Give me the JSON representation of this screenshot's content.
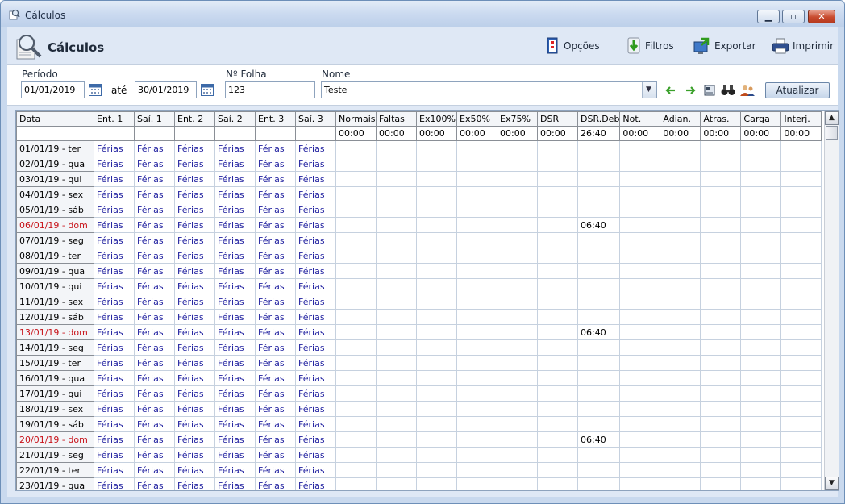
{
  "window": {
    "title": "Cálculos"
  },
  "header": {
    "title": "Cálculos"
  },
  "toolbar": {
    "options": "Opções",
    "filters": "Filtros",
    "export": "Exportar",
    "print": "Imprimir"
  },
  "filters": {
    "period_label": "Período",
    "date_from": "01/01/2019",
    "ate_label": "até",
    "date_to": "30/01/2019",
    "sheet_label": "Nº Folha",
    "sheet": "123",
    "name_label": "Nome",
    "name": "Teste",
    "refresh": "Atualizar"
  },
  "grid": {
    "columns": [
      "Data",
      "Ent. 1",
      "Saí. 1",
      "Ent. 2",
      "Saí. 2",
      "Ent. 3",
      "Saí. 3",
      "Normais",
      "Faltas",
      "Ex100%",
      "Ex50%",
      "Ex75%",
      "DSR",
      "DSR.Deb",
      "Not.",
      "Adian.",
      "Atras.",
      "Carga",
      "Interj."
    ],
    "totals": [
      "",
      "",
      "",
      "",
      "",
      "",
      "",
      "00:00",
      "00:00",
      "00:00",
      "00:00",
      "00:00",
      "00:00",
      "26:40",
      "00:00",
      "00:00",
      "00:00",
      "00:00",
      "00:00"
    ],
    "rows": [
      {
        "date": "01/01/19 - ter",
        "sunday": false,
        "marks": [
          "Férias",
          "Férias",
          "Férias",
          "Férias",
          "Férias",
          "Férias"
        ],
        "dsr_deb": ""
      },
      {
        "date": "02/01/19 - qua",
        "sunday": false,
        "marks": [
          "Férias",
          "Férias",
          "Férias",
          "Férias",
          "Férias",
          "Férias"
        ],
        "dsr_deb": ""
      },
      {
        "date": "03/01/19 - qui",
        "sunday": false,
        "marks": [
          "Férias",
          "Férias",
          "Férias",
          "Férias",
          "Férias",
          "Férias"
        ],
        "dsr_deb": ""
      },
      {
        "date": "04/01/19 - sex",
        "sunday": false,
        "marks": [
          "Férias",
          "Férias",
          "Férias",
          "Férias",
          "Férias",
          "Férias"
        ],
        "dsr_deb": ""
      },
      {
        "date": "05/01/19 - sáb",
        "sunday": false,
        "marks": [
          "Férias",
          "Férias",
          "Férias",
          "Férias",
          "Férias",
          "Férias"
        ],
        "dsr_deb": ""
      },
      {
        "date": "06/01/19 - dom",
        "sunday": true,
        "marks": [
          "Férias",
          "Férias",
          "Férias",
          "Férias",
          "Férias",
          "Férias"
        ],
        "dsr_deb": "06:40"
      },
      {
        "date": "07/01/19 - seg",
        "sunday": false,
        "marks": [
          "Férias",
          "Férias",
          "Férias",
          "Férias",
          "Férias",
          "Férias"
        ],
        "dsr_deb": ""
      },
      {
        "date": "08/01/19 - ter",
        "sunday": false,
        "marks": [
          "Férias",
          "Férias",
          "Férias",
          "Férias",
          "Férias",
          "Férias"
        ],
        "dsr_deb": ""
      },
      {
        "date": "09/01/19 - qua",
        "sunday": false,
        "marks": [
          "Férias",
          "Férias",
          "Férias",
          "Férias",
          "Férias",
          "Férias"
        ],
        "dsr_deb": ""
      },
      {
        "date": "10/01/19 - qui",
        "sunday": false,
        "marks": [
          "Férias",
          "Férias",
          "Férias",
          "Férias",
          "Férias",
          "Férias"
        ],
        "dsr_deb": ""
      },
      {
        "date": "11/01/19 - sex",
        "sunday": false,
        "marks": [
          "Férias",
          "Férias",
          "Férias",
          "Férias",
          "Férias",
          "Férias"
        ],
        "dsr_deb": ""
      },
      {
        "date": "12/01/19 - sáb",
        "sunday": false,
        "marks": [
          "Férias",
          "Férias",
          "Férias",
          "Férias",
          "Férias",
          "Férias"
        ],
        "dsr_deb": ""
      },
      {
        "date": "13/01/19 - dom",
        "sunday": true,
        "marks": [
          "Férias",
          "Férias",
          "Férias",
          "Férias",
          "Férias",
          "Férias"
        ],
        "dsr_deb": "06:40"
      },
      {
        "date": "14/01/19 - seg",
        "sunday": false,
        "marks": [
          "Férias",
          "Férias",
          "Férias",
          "Férias",
          "Férias",
          "Férias"
        ],
        "dsr_deb": ""
      },
      {
        "date": "15/01/19 - ter",
        "sunday": false,
        "marks": [
          "Férias",
          "Férias",
          "Férias",
          "Férias",
          "Férias",
          "Férias"
        ],
        "dsr_deb": ""
      },
      {
        "date": "16/01/19 - qua",
        "sunday": false,
        "marks": [
          "Férias",
          "Férias",
          "Férias",
          "Férias",
          "Férias",
          "Férias"
        ],
        "dsr_deb": ""
      },
      {
        "date": "17/01/19 - qui",
        "sunday": false,
        "marks": [
          "Férias",
          "Férias",
          "Férias",
          "Férias",
          "Férias",
          "Férias"
        ],
        "dsr_deb": ""
      },
      {
        "date": "18/01/19 - sex",
        "sunday": false,
        "marks": [
          "Férias",
          "Férias",
          "Férias",
          "Férias",
          "Férias",
          "Férias"
        ],
        "dsr_deb": ""
      },
      {
        "date": "19/01/19 - sáb",
        "sunday": false,
        "marks": [
          "Férias",
          "Férias",
          "Férias",
          "Férias",
          "Férias",
          "Férias"
        ],
        "dsr_deb": ""
      },
      {
        "date": "20/01/19 - dom",
        "sunday": true,
        "marks": [
          "Férias",
          "Férias",
          "Férias",
          "Férias",
          "Férias",
          "Férias"
        ],
        "dsr_deb": "06:40"
      },
      {
        "date": "21/01/19 - seg",
        "sunday": false,
        "marks": [
          "Férias",
          "Férias",
          "Férias",
          "Férias",
          "Férias",
          "Férias"
        ],
        "dsr_deb": ""
      },
      {
        "date": "22/01/19 - ter",
        "sunday": false,
        "marks": [
          "Férias",
          "Férias",
          "Férias",
          "Férias",
          "Férias",
          "Férias"
        ],
        "dsr_deb": ""
      },
      {
        "date": "23/01/19 - qua",
        "sunday": false,
        "marks": [
          "Férias",
          "Férias",
          "Férias",
          "Férias",
          "Férias",
          "Férias"
        ],
        "dsr_deb": ""
      }
    ]
  }
}
